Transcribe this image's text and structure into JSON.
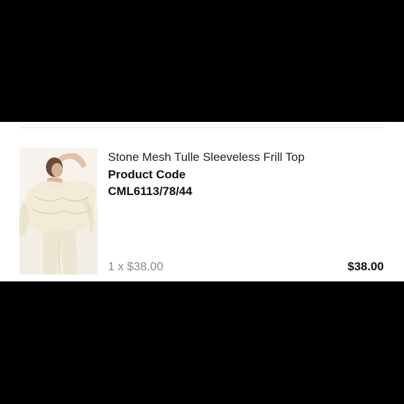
{
  "cart_item": {
    "product_name": "Stone Mesh Tulle Sleeveless Frill Top",
    "code_label": "Product Code",
    "code_value": "CML6113/78/44",
    "quantity_price": "1 x $38.00",
    "line_total": "$38.00",
    "image_icon": "product-photo"
  },
  "colors": {
    "panel_background": "#ffffff",
    "letterbox": "#000000",
    "text_primary": "#111111",
    "text_muted": "#8a8a8a"
  }
}
